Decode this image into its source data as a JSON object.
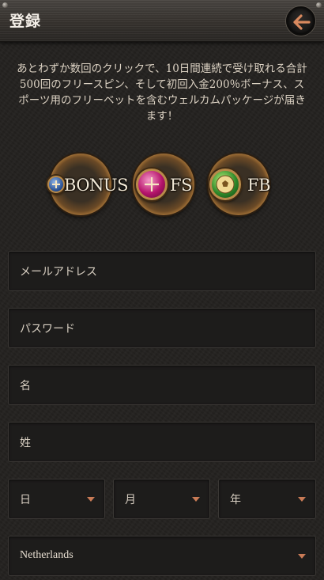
{
  "header": {
    "title": "登録",
    "back_icon": "arrow-left-icon",
    "accent": "#d9895e"
  },
  "promo": {
    "text": "あとわずか数回のクリックで、10日間連続で受け取れる合計500回のフリースピン、そして初回入金200％ボーナス、スポーツ用のフリーベットを含むウェルカムパッケージが届きます！"
  },
  "badges": [
    {
      "label": "BONUS",
      "icon": "plus-gem-icon"
    },
    {
      "label": "FS",
      "icon": "plus-gem-icon"
    },
    {
      "label": "FB",
      "icon": "soccer-ball-icon"
    }
  ],
  "form": {
    "email_placeholder": "メールアドレス",
    "password_placeholder": "パスワード",
    "first_name_placeholder": "名",
    "last_name_placeholder": "姓",
    "day_label": "日",
    "month_label": "月",
    "year_label": "年",
    "country_value": "Netherlands"
  }
}
